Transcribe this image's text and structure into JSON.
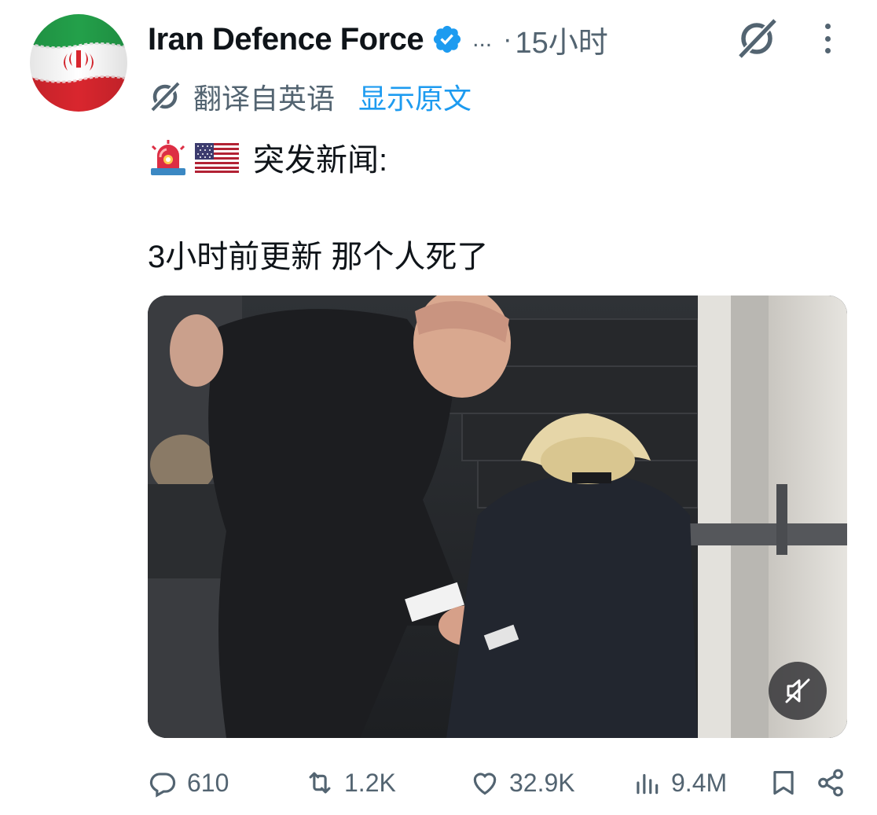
{
  "post": {
    "author": {
      "display_name": "Iran Defence Force",
      "verified": true,
      "overflow_text": "...",
      "separator": "·",
      "timestamp": "15小时"
    },
    "translation": {
      "label": "翻译自英语",
      "show_original": "显示原文"
    },
    "text": {
      "line1": "突发新闻:",
      "line2": "3小时前更新 那个人死了"
    },
    "emojis": [
      "rotating-light-emoji",
      "us-flag-emoji"
    ],
    "media": {
      "type": "video",
      "muted": true
    },
    "actions": {
      "replies": "610",
      "reposts": "1.2K",
      "likes": "32.9K",
      "views": "9.4M"
    }
  },
  "colors": {
    "text_primary": "#0f1419",
    "text_secondary": "#536471",
    "link": "#1d9bf0",
    "verified": "#1d9bf0"
  }
}
